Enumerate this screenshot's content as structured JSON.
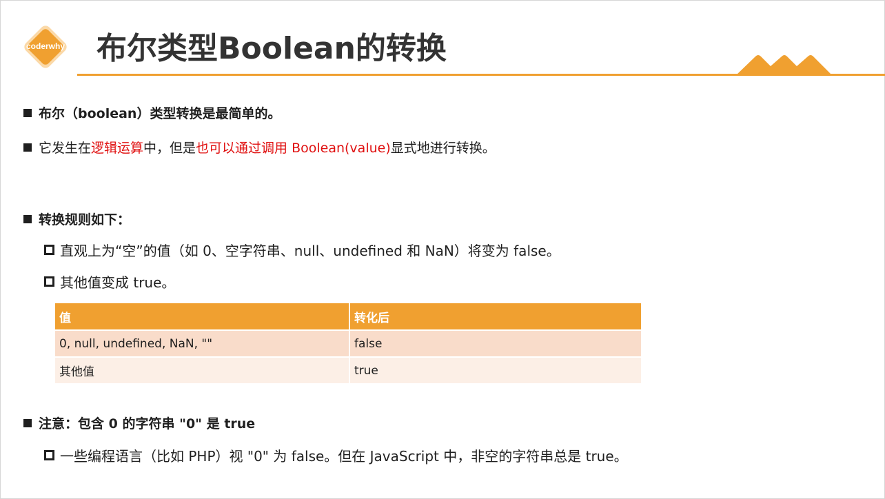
{
  "header": {
    "logo_text": "coderwhy",
    "title": "布尔类型Boolean的转换"
  },
  "bullets": {
    "b1": "布尔（boolean）类型转换是最简单的。",
    "b2": {
      "p1": "它发生在",
      "p2": "逻辑运算",
      "p3": "中，但是",
      "p4": "也可以通过调用 Boolean(value)",
      "p5": " 显式地进行转换。"
    },
    "b3": "转换规则如下：",
    "b3_sub1": "直观上为“空”的值（如 0、空字符串、null、undefined 和 NaN）将变为 false。",
    "b3_sub2": "其他值变成 true。",
    "b4": "注意：包含 0 的字符串 \"0\" 是 true",
    "b4_sub1": "一些编程语言（比如 PHP）视 \"0\" 为 false。但在 JavaScript 中，非空的字符串总是 true。"
  },
  "table": {
    "headers": [
      "值",
      "转化后"
    ],
    "rows": [
      [
        "0, null, undefined, NaN, \"\"",
        "false"
      ],
      [
        "其他值",
        "true"
      ]
    ]
  },
  "colors": {
    "accent": "#f0a030",
    "highlight": "#e01010",
    "row_odd": "#f9dcca",
    "row_even": "#fcefe6"
  }
}
